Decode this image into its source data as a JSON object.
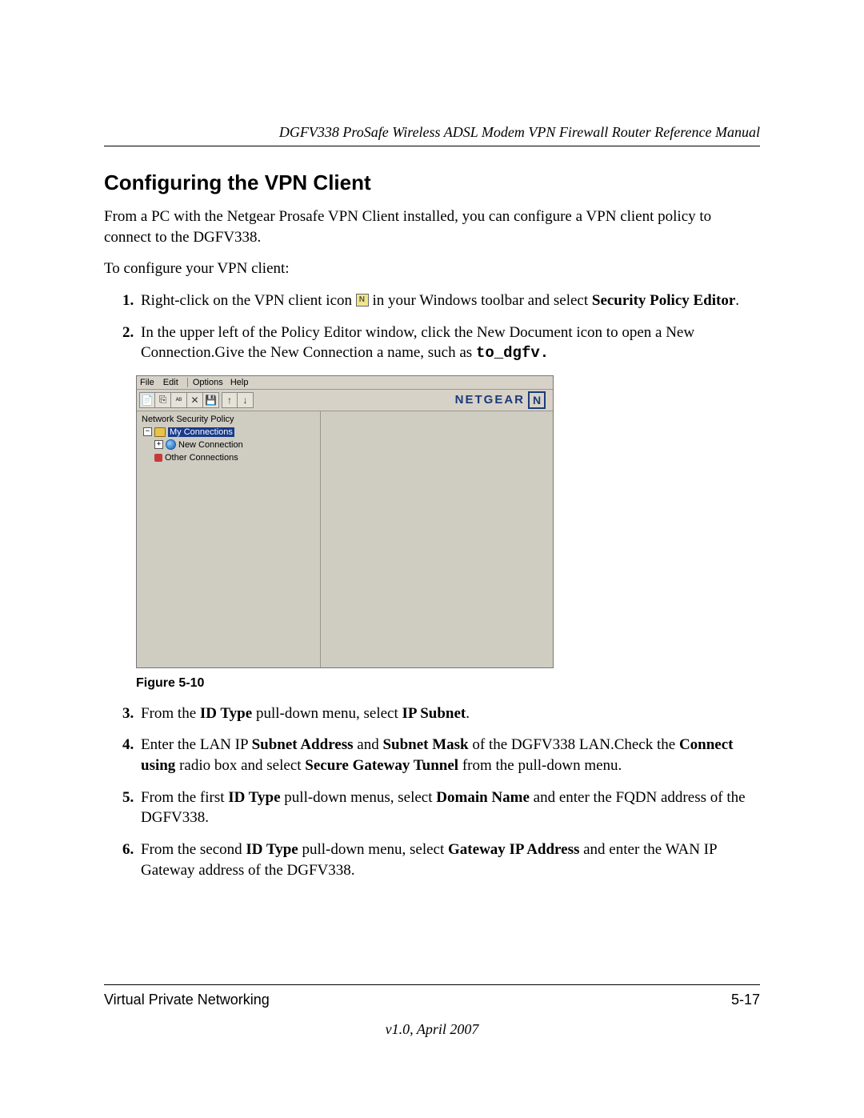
{
  "header": {
    "running_title": "DGFV338 ProSafe Wireless ADSL Modem VPN Firewall Router Reference Manual"
  },
  "section": {
    "title": "Configuring the VPN Client",
    "intro": "From a PC with the Netgear Prosafe VPN Client installed, you can configure a VPN client policy to connect to the DGFV338.",
    "lead_in": "To configure your VPN client:"
  },
  "steps": {
    "s1_a": "Right-click on the VPN client icon ",
    "s1_b": " in your Windows toolbar and select ",
    "s1_bold": "Security Policy Editor",
    "s1_c": ".",
    "s2_a": "In the upper left of the Policy Editor window, click the New Document icon to open a New Connection.Give the New Connection a name, such as ",
    "s2_code": "to_dgfv.",
    "s3_a": "From the ",
    "s3_b1": "ID Type",
    "s3_b": " pull-down menu, select ",
    "s3_b2": "IP Subnet",
    "s3_c": ".",
    "s4_a": "Enter the LAN IP ",
    "s4_b1": "Subnet Address",
    "s4_b": " and ",
    "s4_b2": "Subnet Mask",
    "s4_c": " of the DGFV338 LAN.Check the ",
    "s4_b3": "Connect using",
    "s4_d": " radio box and select ",
    "s4_b4": "Secure Gateway Tunnel",
    "s4_e": " from the pull-down menu.",
    "s5_a": "From the first ",
    "s5_b1": "ID Type",
    "s5_b": " pull-down menus, select ",
    "s5_b2": "Domain Name",
    "s5_c": " and enter the FQDN address of the DGFV338.",
    "s6_a": "From the second ",
    "s6_b1": "ID Type",
    "s6_b": " pull-down menu, select ",
    "s6_b2": "Gateway IP Address",
    "s6_c": " and enter the WAN IP Gateway address of the DGFV338."
  },
  "figure": {
    "caption": "Figure 5-10",
    "menubar": [
      "File",
      "Edit",
      "Options",
      "Help"
    ],
    "tree_title": "Network Security Policy",
    "tree_root": "My Connections",
    "tree_item1": "New Connection",
    "tree_item2": "Other Connections",
    "logo_text": "NETGEAR",
    "logo_glyph": "N"
  },
  "footer": {
    "chapter": "Virtual Private Networking",
    "page": "5-17",
    "version": "v1.0, April 2007"
  }
}
